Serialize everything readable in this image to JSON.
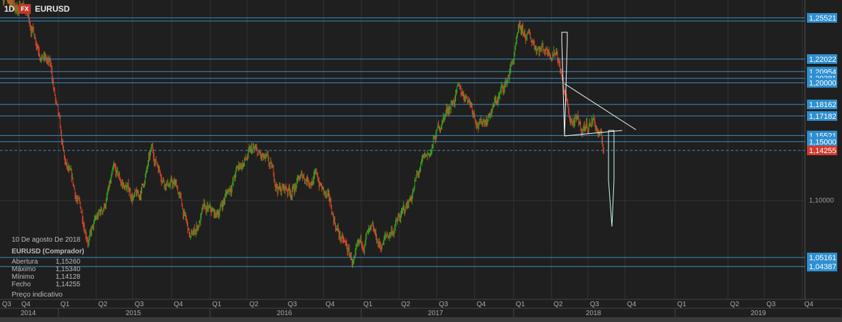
{
  "header": {
    "timeframe": "1D",
    "badge": "FX",
    "symbol": "EURUSD"
  },
  "info": {
    "date": "10 De agosto De 2018",
    "title": "EURUSD (Comprador)",
    "rows": [
      {
        "label": "Abertura",
        "value": "1,15260"
      },
      {
        "label": "Máximo",
        "value": "1,15340"
      },
      {
        "label": "Mínimo",
        "value": "1,14128"
      },
      {
        "label": "Fecho",
        "value": "1,14255"
      }
    ],
    "note": "Preço indicativo"
  },
  "colors": {
    "up": "#3f9c1f",
    "down": "#d8472b",
    "level": "#3d8fc4",
    "label_bg": "#2f8fd0",
    "current_bg": "#d03a30"
  },
  "chart_data": {
    "type": "candlestick",
    "symbol": "EURUSD",
    "timeframe": "1D",
    "ylim": [
      1.03,
      1.28
    ],
    "y_tick_labels": [
      "1,10000"
    ],
    "x_quarters": [
      "Q3",
      "Q4",
      "Q1",
      "Q2",
      "Q3",
      "Q4",
      "Q1",
      "Q2",
      "Q3",
      "Q4",
      "Q1",
      "Q2",
      "Q3",
      "Q4",
      "Q1",
      "Q2",
      "Q3",
      "Q4",
      "Q1",
      "Q2",
      "Q3",
      "Q4"
    ],
    "x_years": [
      "2014",
      "2015",
      "2016",
      "2017",
      "2018",
      "2019"
    ],
    "levels": [
      {
        "price": 1.25521,
        "label": "1,25521"
      },
      {
        "price": 1.2525,
        "label": ""
      },
      {
        "price": 1.22022,
        "label": "1,22022"
      },
      {
        "price": 1.20954,
        "label": "1,20954"
      },
      {
        "price": 1.20381,
        "label": "1,20381"
      },
      {
        "price": 1.2,
        "label": "1,20000"
      },
      {
        "price": 1.18162,
        "label": "1,18162"
      },
      {
        "price": 1.17182,
        "label": "1,17182"
      },
      {
        "price": 1.15521,
        "label": "1,15521"
      },
      {
        "price": 1.15,
        "label": "1,15000"
      },
      {
        "price": 1.05161,
        "label": "1,05161"
      },
      {
        "price": 1.04387,
        "label": "1,04387"
      }
    ],
    "current": {
      "price": 1.14255,
      "label": "1,14255"
    },
    "approx_monthly_close": [
      [
        "2014-07",
        1.275
      ],
      [
        "2014-10",
        1.26
      ],
      [
        "2014-12",
        1.21
      ],
      [
        "2015-01",
        1.13
      ],
      [
        "2015-03",
        1.07
      ],
      [
        "2015-04",
        1.09
      ],
      [
        "2015-05",
        1.12
      ],
      [
        "2015-06",
        1.11
      ],
      [
        "2015-07",
        1.1
      ],
      [
        "2015-08",
        1.14
      ],
      [
        "2015-09",
        1.12
      ],
      [
        "2015-10",
        1.11
      ],
      [
        "2015-11",
        1.065
      ],
      [
        "2015-12",
        1.09
      ],
      [
        "2016-01",
        1.085
      ],
      [
        "2016-02",
        1.11
      ],
      [
        "2016-03",
        1.13
      ],
      [
        "2016-04",
        1.14
      ],
      [
        "2016-05",
        1.13
      ],
      [
        "2016-06",
        1.11
      ],
      [
        "2016-07",
        1.11
      ],
      [
        "2016-08",
        1.12
      ],
      [
        "2016-09",
        1.12
      ],
      [
        "2016-10",
        1.095
      ],
      [
        "2016-11",
        1.065
      ],
      [
        "2016-12",
        1.045
      ],
      [
        "2017-01",
        1.07
      ],
      [
        "2017-02",
        1.06
      ],
      [
        "2017-03",
        1.075
      ],
      [
        "2017-04",
        1.09
      ],
      [
        "2017-05",
        1.12
      ],
      [
        "2017-06",
        1.14
      ],
      [
        "2017-07",
        1.17
      ],
      [
        "2017-08",
        1.19
      ],
      [
        "2017-09",
        1.19
      ],
      [
        "2017-10",
        1.165
      ],
      [
        "2017-11",
        1.18
      ],
      [
        "2017-12",
        1.2
      ],
      [
        "2018-01",
        1.24
      ],
      [
        "2018-02",
        1.235
      ],
      [
        "2018-03",
        1.23
      ],
      [
        "2018-04",
        1.23
      ],
      [
        "2018-05",
        1.17
      ],
      [
        "2018-06",
        1.16
      ],
      [
        "2018-07",
        1.17
      ],
      [
        "2018-08-10",
        1.14255
      ]
    ]
  }
}
